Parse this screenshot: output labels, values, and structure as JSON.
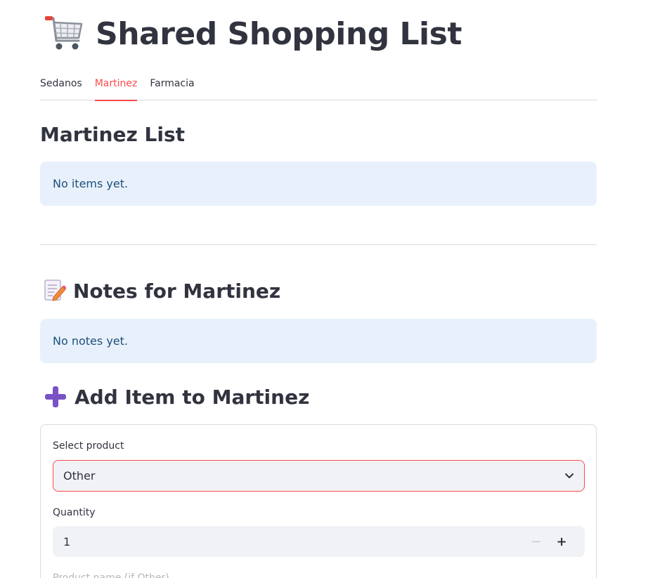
{
  "header": {
    "title": "Shared Shopping List",
    "icon": "shopping-cart-icon"
  },
  "tabs": [
    {
      "label": "Sedanos",
      "active": false
    },
    {
      "label": "Martinez",
      "active": true
    },
    {
      "label": "Farmacia",
      "active": false
    }
  ],
  "list_section": {
    "heading": "Martinez List",
    "empty_message": "No items yet."
  },
  "notes_section": {
    "heading": "Notes for Martinez",
    "icon": "memo-icon",
    "empty_message": "No notes yet."
  },
  "add_section": {
    "heading": "Add Item to Martinez",
    "icon": "plus-icon",
    "product_label": "Select product",
    "product_value": "Other",
    "quantity_label": "Quantity",
    "quantity_value": "1",
    "next_label_partial": "Product name (if Other)"
  },
  "colors": {
    "accent": "#ff4b4b",
    "info_bg": "#e8f1fb",
    "info_text": "#1d4f7c"
  }
}
